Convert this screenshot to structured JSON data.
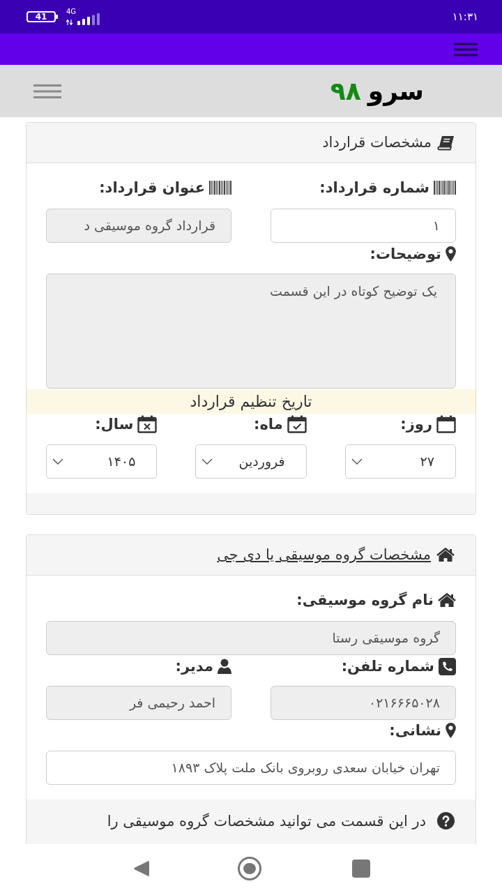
{
  "status_bar": {
    "battery": "41",
    "network": "4G",
    "time": "۱۱:۳۱"
  },
  "header": {
    "logo_name": "سرو",
    "logo_number": "۹۸"
  },
  "contract_card": {
    "title": "مشخصات قرارداد",
    "contract_number": {
      "label": "شماره قرارداد:",
      "value": "۱",
      "disabled": false
    },
    "contract_title": {
      "label": "عنوان قرارداد:",
      "value": "قرارداد گروه موسیقی د",
      "disabled": true
    },
    "description": {
      "label": "توضیحات:",
      "value": "یک توضیح کوتاه در این قسمت",
      "disabled": true
    },
    "date_heading": "تاریخ تنظیم قرارداد",
    "day": {
      "label": "روز:",
      "value": "۲۷"
    },
    "month": {
      "label": "ماه:",
      "value": "فروردین"
    },
    "year": {
      "label": "سال:",
      "value": "۱۴۰۵"
    }
  },
  "band_card": {
    "title": "مشخصات گروه موسیقی یا دی جی",
    "band_name": {
      "label": "نام گروه موسیقی:",
      "value": "گروه موسیقی رستا",
      "disabled": true
    },
    "phone": {
      "label": "شماره تلفن:",
      "value": "۰۲۱۶۶۶۵۰۲۸",
      "disabled": true
    },
    "manager": {
      "label": "مدیر:",
      "value": "احمد رحیمی فر",
      "disabled": true
    },
    "address": {
      "label": "نشانی:",
      "value": "تهران خیابان سعدی روبروی بانک ملت پلاک ۱۸۹۳",
      "disabled": false
    },
    "help_text": "در این قسمت می توانید مشخصات گروه موسیقی را"
  }
}
